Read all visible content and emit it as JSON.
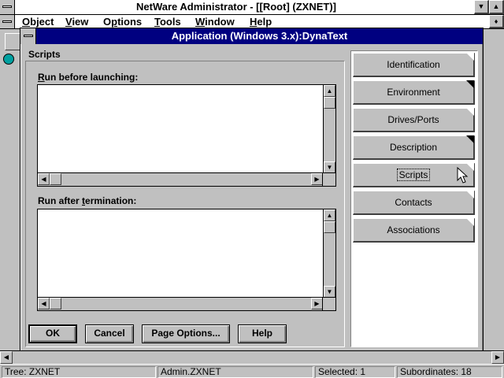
{
  "window": {
    "title": "NetWare Administrator - [[Root] (ZXNET)]"
  },
  "menu": {
    "items": [
      "Object",
      "View",
      "Options",
      "Tools",
      "Window",
      "Help"
    ],
    "mnemonics": [
      "O",
      "V",
      "p",
      "T",
      "W",
      "H"
    ]
  },
  "dialog": {
    "title": "Application (Windows 3.x):DynaText",
    "section_label": "Scripts",
    "run_before_label_first": "R",
    "run_before_label_rest": "un before launching:",
    "run_after_label_pre": "Run after ",
    "run_after_label_mn": "t",
    "run_after_label_post": "ermination:",
    "run_before_value": "",
    "run_after_value": "",
    "pages": [
      {
        "label": "Identification",
        "active": false,
        "dark_fold": false
      },
      {
        "label": "Environment",
        "active": false,
        "dark_fold": true
      },
      {
        "label": "Drives/Ports",
        "active": false,
        "dark_fold": false
      },
      {
        "label": "Description",
        "active": false,
        "dark_fold": true
      },
      {
        "label": "Scripts",
        "active": true,
        "dark_fold": false
      },
      {
        "label": "Contacts",
        "active": false,
        "dark_fold": false
      },
      {
        "label": "Associations",
        "active": false,
        "dark_fold": false
      }
    ],
    "buttons": {
      "ok": "OK",
      "cancel": "Cancel",
      "page_options": "Page Options...",
      "help": "Help"
    }
  },
  "status": {
    "tree": "Tree: ZXNET",
    "user": "Admin.ZXNET",
    "selected": "Selected: 1",
    "subordinates": "Subordinates: 18"
  },
  "icons": {
    "system_menu": "system-menu-icon",
    "minimize": "minimize-icon",
    "maximize": "maximize-icon",
    "arrow_up": "arrow-up-icon",
    "arrow_down": "arrow-down-icon",
    "arrow_left": "arrow-left-icon",
    "arrow_right": "arrow-right-icon",
    "cursor": "mouse-pointer-icon"
  },
  "colors": {
    "face": "#c0c0c0",
    "dialog_title_bg": "#000080",
    "dialog_title_fg": "#ffffff"
  }
}
